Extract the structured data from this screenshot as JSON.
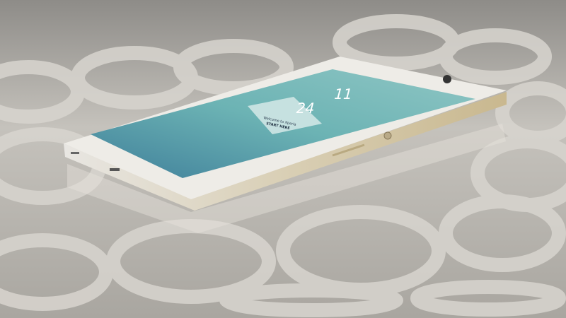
{
  "photo": {
    "subject": "smartphone lying on glass table",
    "screen": {
      "clock_hour": "11",
      "clock_minute": "24",
      "welcome_title": "Welcome to Xperia",
      "welcome_action": "START HERE"
    },
    "colors": {
      "background": "#bfbcb6",
      "phone_body": "#ece9e2",
      "phone_frame": "#cfc3a4",
      "screen_teal": "#5fa7b0"
    }
  }
}
